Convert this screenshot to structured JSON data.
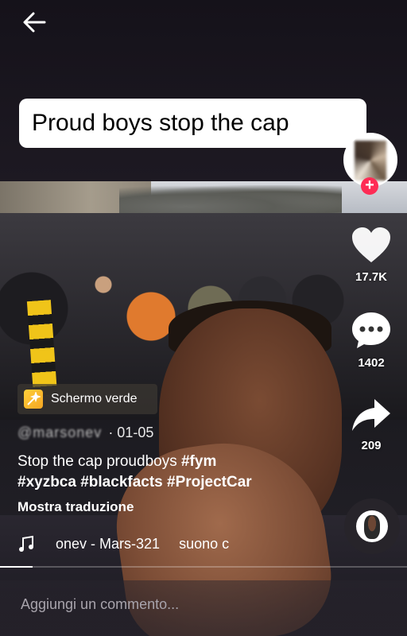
{
  "caption_overlay": "Proud boys stop the cap",
  "actions": {
    "likes": "17.7K",
    "comments": "1402",
    "shares": "209"
  },
  "effect": {
    "label": "Schermo verde"
  },
  "post": {
    "author": "@marsonev",
    "date": "· 01-05",
    "description_text": "Stop the cap proudboys ",
    "tags": [
      "#fym",
      "#xyzbca",
      "#blackfacts",
      "#ProjectCar"
    ]
  },
  "translate_label": "Mostra traduzione",
  "sound": {
    "title": "onev - Mars-321",
    "suffix": "suono c"
  },
  "playback": {
    "progress": 0.08
  },
  "comment": {
    "placeholder": "Aggiungi un commento..."
  },
  "colors": {
    "accent": "#fe2c55",
    "caption_bg": "#ffffff"
  },
  "icons": {
    "back": "arrow-left-icon",
    "like": "heart-icon",
    "comment": "speech-bubble-icon",
    "share": "share-arrow-icon",
    "effect": "magic-wand-icon",
    "sound": "music-note-icon",
    "follow": "plus-icon"
  }
}
